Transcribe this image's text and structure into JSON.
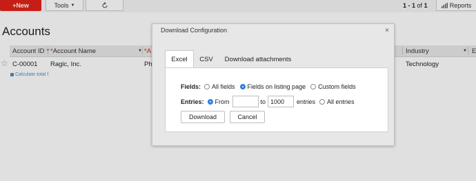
{
  "toolbar": {
    "new_label": "+New",
    "tools_label": "Tools",
    "pager": {
      "range": "1 - 1",
      "of": "of",
      "total": "1"
    },
    "reports_label": "Reports"
  },
  "page": {
    "title": "Accounts"
  },
  "grid": {
    "columns": [
      {
        "label": "Account ID",
        "required": false
      },
      {
        "label": "Account Name",
        "required": true
      },
      {
        "label": "A",
        "required": true
      },
      {
        "label": "Industry",
        "required": false
      },
      {
        "label": "E",
        "required": false
      }
    ],
    "rows": [
      {
        "account_id": "C-00001",
        "account_name": "Ragic, Inc.",
        "partial": "Ph",
        "industry": "Technology"
      }
    ],
    "calculate_label": "Calculate total f"
  },
  "dialog": {
    "title": "Download Configuration",
    "close_glyph": "×",
    "tabs": [
      {
        "label": "Excel",
        "active": true
      },
      {
        "label": "CSV",
        "active": false
      },
      {
        "label": "Download attachments",
        "active": false
      }
    ],
    "fields": {
      "label": "Fields:",
      "options": [
        {
          "label": "All fields",
          "selected": false
        },
        {
          "label": "Fields on listing page",
          "selected": true
        },
        {
          "label": "Custom fields",
          "selected": false
        }
      ]
    },
    "entries": {
      "label": "Entries:",
      "from_label": "From",
      "from_value": "",
      "to_label": "to",
      "to_value": "1000",
      "entries_label": "entries",
      "all_label": "All entries",
      "from_selected": true,
      "all_selected": false
    },
    "download_label": "Download",
    "cancel_label": "Cancel"
  },
  "colors": {
    "brand_red": "#e2231a",
    "radio_blue": "#2f7ee0"
  }
}
